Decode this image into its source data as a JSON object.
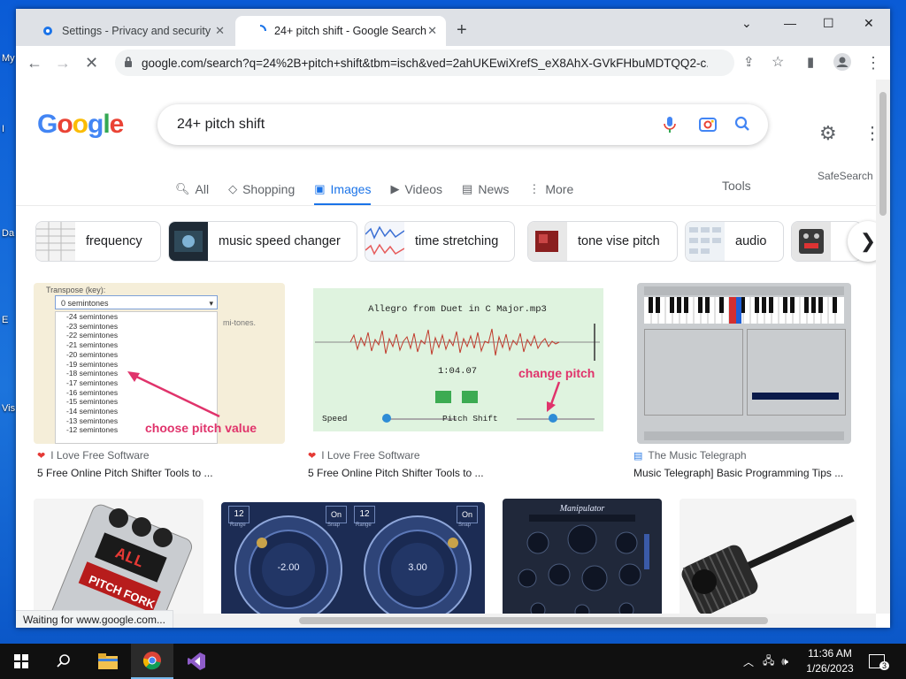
{
  "desktop": {
    "labels": [
      "My",
      "I",
      "Da",
      "E",
      "Vis"
    ]
  },
  "browser": {
    "tabs": [
      {
        "title": "Settings - Privacy and security",
        "icon": "gear-icon"
      },
      {
        "title": "24+ pitch shift - Google Search",
        "icon": "loading-spinner-icon"
      }
    ],
    "url": "google.com/search?q=24%2B+pitch+shift&tbm=isch&ved=2ahUKEwiXrefS_eX8AhX-GVkFHbuMDTQQ2-c...",
    "status": "Waiting for www.google.com..."
  },
  "google": {
    "logo": "Google",
    "query": "24+ pitch shift",
    "nav": [
      "All",
      "Shopping",
      "Images",
      "Videos",
      "News",
      "More"
    ],
    "active_nav": "Images",
    "tools": "Tools",
    "safesearch": "SafeSearch",
    "chips": [
      "frequency",
      "music speed changer",
      "time stretching",
      "tone vise pitch",
      "audio"
    ]
  },
  "results": [
    {
      "source": "I Love Free Software",
      "title": "5 Free Online Pitch Shifter Tools to ...",
      "image": {
        "transpose_label": "Transpose (key):",
        "selected": "0 semintones",
        "options": [
          "-24 semintones",
          "-23 semintones",
          "-22 semintones",
          "-21 semintones",
          "-20 semintones",
          "-19 semintones",
          "-18 semintones",
          "-17 semintones",
          "-16 semintones",
          "-15 semintones",
          "-14 semintones",
          "-13 semintones",
          "-12 semintones"
        ],
        "side_text": "mi-tones.",
        "annotation": "choose pitch value"
      }
    },
    {
      "source": "I Love Free Software",
      "title": "5 Free Online Pitch Shifter Tools to ...",
      "image": {
        "file": "Allegro from Duet in C Major.mp3",
        "time": "1:04.07",
        "annotation": "change pitch",
        "speed_label": "Speed",
        "pitch_label": "Pitch Shift"
      }
    },
    {
      "source": "The Music Telegraph",
      "title": "Music Telegraph] Basic Programming Tips ..."
    },
    {
      "image": {
        "pedal_text": "PITCH FORK",
        "display": "ALL"
      }
    },
    {
      "image": {
        "knob_left": "-2.00",
        "knob_right": "3.00",
        "range_label": "Range",
        "range_value": "12",
        "snap_label": "Snap",
        "snap_value": "On"
      }
    },
    {
      "image": {
        "plugin_name": "Manipulator"
      }
    },
    {}
  ],
  "taskbar": {
    "time": "11:36 AM",
    "date": "1/26/2023",
    "notifications": "3"
  },
  "colors": {
    "google_blue": "#4285F4",
    "google_red": "#EA4335",
    "google_yellow": "#FBBC05",
    "google_green": "#34A853",
    "link_blue": "#1a73e8"
  }
}
